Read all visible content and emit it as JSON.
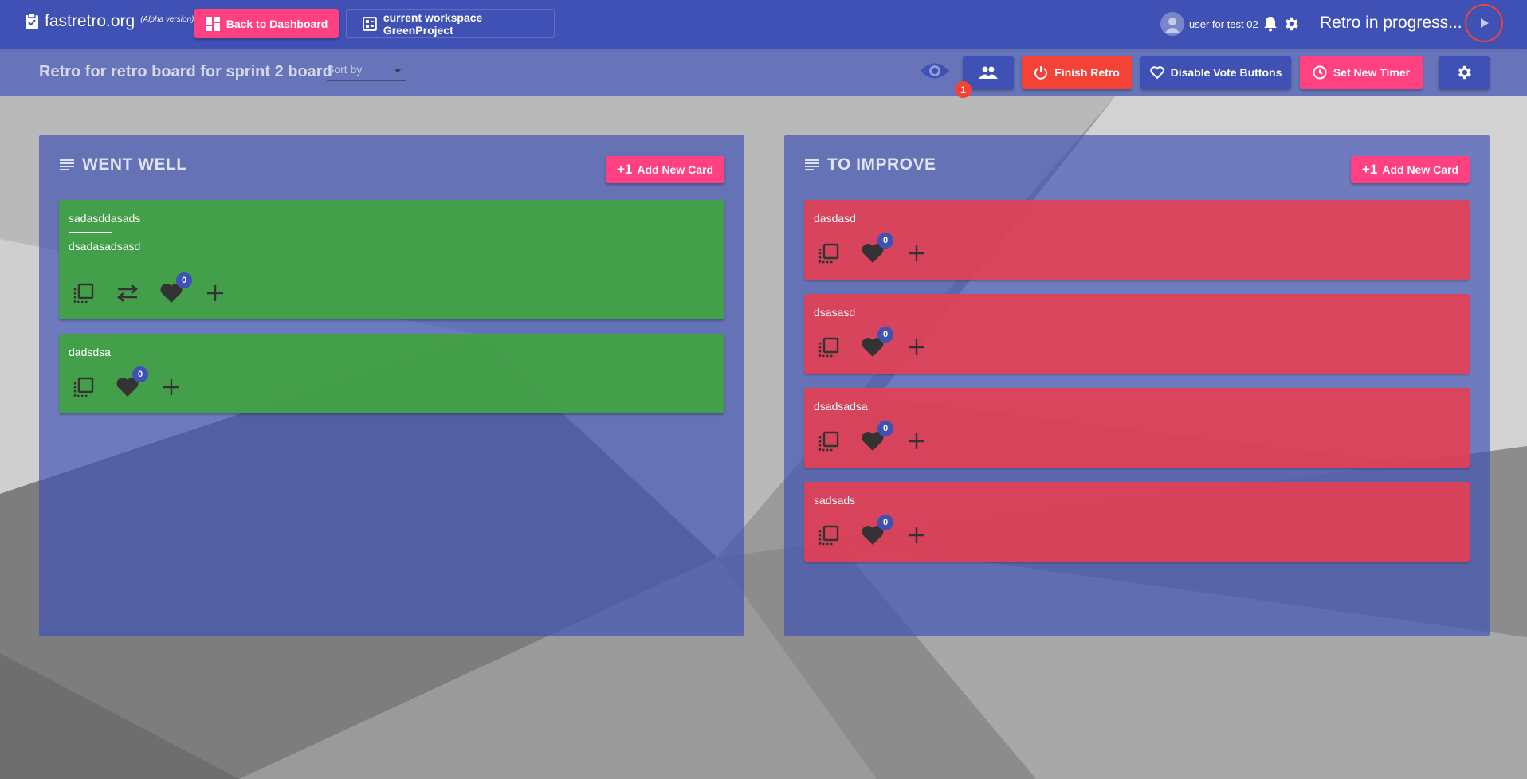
{
  "header": {
    "brand": "fastretro.org",
    "brand_tag": "(Alpha version)",
    "back_label": "Back to Dashboard",
    "workspace_label": "current workspace GreenProject",
    "user_name": "user for test 02",
    "retro_status": "Retro in progress..."
  },
  "toolbar": {
    "board_title": "Retro for retro board for sprint 2 board",
    "sort_placeholder": "Sort by",
    "viewers_count": "1",
    "finish_label": "Finish Retro",
    "disable_votes_label": "Disable Vote Buttons",
    "timer_label": "Set New Timer"
  },
  "columns": [
    {
      "title": "WENT WELL",
      "add_label": "Add New Card",
      "add_prefix": "+1",
      "color": "#43a047",
      "cards": [
        {
          "lines": [
            "sadasddasads",
            "dsadasadsasd"
          ],
          "votes": "0"
        },
        {
          "lines": [
            "dadsdsa"
          ],
          "votes": "0"
        }
      ]
    },
    {
      "title": "TO IMPROVE",
      "add_label": "Add New Card",
      "add_prefix": "+1",
      "color": "#e83d50",
      "cards": [
        {
          "lines": [
            "dasdasd"
          ],
          "votes": "0"
        },
        {
          "lines": [
            "dsasasd"
          ],
          "votes": "0"
        },
        {
          "lines": [
            "dsadsadsa"
          ],
          "votes": "0"
        },
        {
          "lines": [
            "sadsads"
          ],
          "votes": "0"
        }
      ]
    }
  ],
  "colors": {
    "primary": "#3f51b5",
    "accent": "#ff4081",
    "danger": "#f44336"
  }
}
